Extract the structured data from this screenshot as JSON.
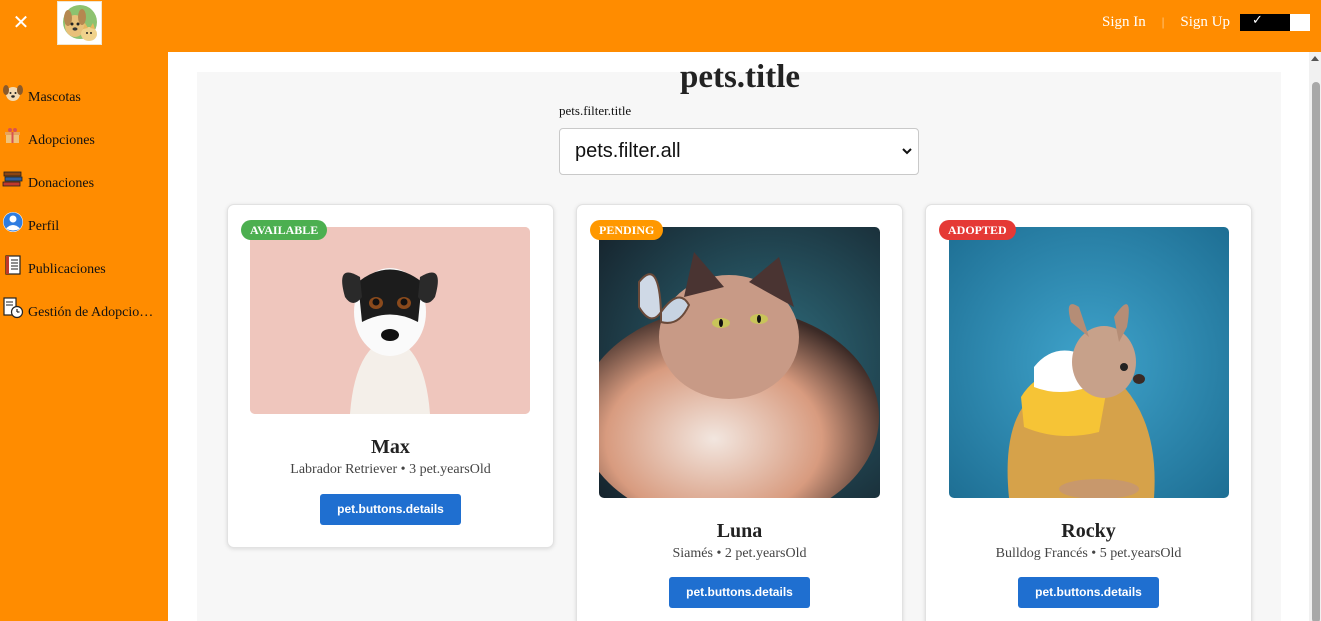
{
  "topbar": {
    "close_icon": "close-icon",
    "logo": "dog-and-cat-logo",
    "sign_in": "Sign In",
    "separator": "|",
    "sign_up": "Sign Up",
    "theme_toggle_icon": "checkmark-icon",
    "color": "#ff8c00"
  },
  "sidebar": {
    "items": [
      {
        "label": "Mascotas",
        "icon": "dog-face-icon"
      },
      {
        "label": "Adopciones",
        "icon": "gift-box-icon"
      },
      {
        "label": "Donaciones",
        "icon": "books-icon"
      },
      {
        "label": "Perfil",
        "icon": "user-icon"
      },
      {
        "label": "Publicaciones",
        "icon": "ledger-icon"
      },
      {
        "label": "Gestión de Adopciones",
        "icon": "document-clock-icon"
      }
    ]
  },
  "main": {
    "title": "pets.title",
    "filter": {
      "label": "pets.filter.title",
      "selected": "pets.filter.all"
    }
  },
  "pets": [
    {
      "name": "Max",
      "breed": "Labrador Retriever",
      "age": "3",
      "age_unit": "pet.yearsOld",
      "info": "Labrador Retriever • 3 pet.yearsOld",
      "status": "AVAILABLE",
      "status_color": "#4caf50",
      "button": "pet.buttons.details"
    },
    {
      "name": "Luna",
      "breed": "Siamés",
      "age": "2",
      "age_unit": "pet.yearsOld",
      "info": "Siamés • 2 pet.yearsOld",
      "status": "PENDING",
      "status_color": "#ff9800",
      "button": "pet.buttons.details"
    },
    {
      "name": "Rocky",
      "breed": "Bulldog Francés",
      "age": "5",
      "age_unit": "pet.yearsOld",
      "info": "Bulldog Francés • 5 pet.yearsOld",
      "status": "ADOPTED",
      "status_color": "#e53935",
      "button": "pet.buttons.details"
    }
  ],
  "colors": {
    "button": "#1f6fd0",
    "main_bg": "#f7f7f7"
  }
}
